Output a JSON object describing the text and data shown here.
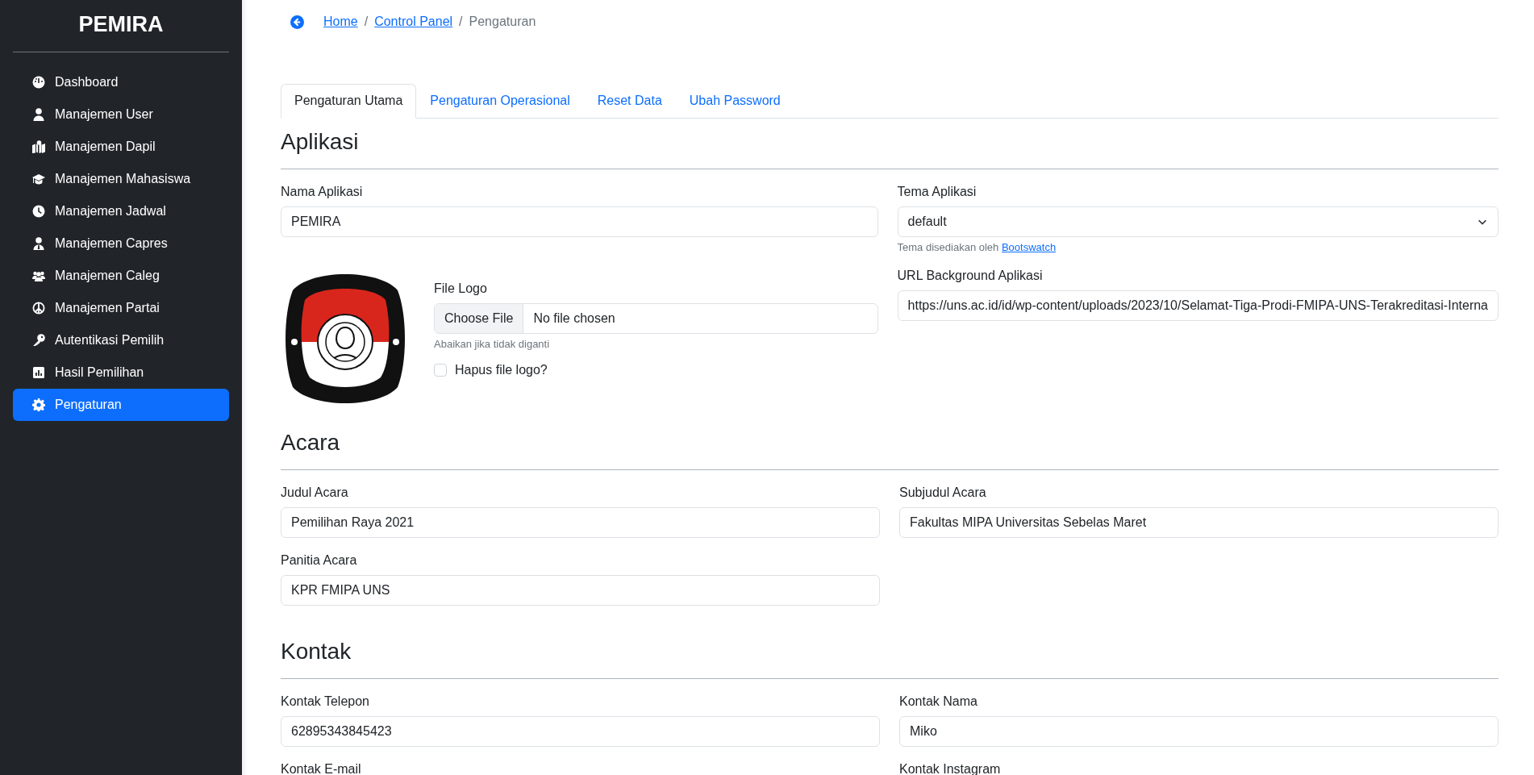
{
  "sidebar": {
    "brand": "PEMIRA",
    "items": [
      {
        "label": "Dashboard",
        "selected": false
      },
      {
        "label": "Manajemen User",
        "selected": false
      },
      {
        "label": "Manajemen Dapil",
        "selected": false
      },
      {
        "label": "Manajemen Mahasiswa",
        "selected": false
      },
      {
        "label": "Manajemen Jadwal",
        "selected": false
      },
      {
        "label": "Manajemen Capres",
        "selected": false
      },
      {
        "label": "Manajemen Caleg",
        "selected": false
      },
      {
        "label": "Manajemen Partai",
        "selected": false
      },
      {
        "label": "Autentikasi Pemilih",
        "selected": false
      },
      {
        "label": "Hasil Pemilihan",
        "selected": false
      },
      {
        "label": "Pengaturan",
        "selected": true
      }
    ]
  },
  "breadcrumb": [
    {
      "label": "Home",
      "kind": "link"
    },
    {
      "label": "/",
      "kind": "separator"
    },
    {
      "label": "Control Panel",
      "kind": "link"
    },
    {
      "label": "/",
      "kind": "separator"
    },
    {
      "label": "Pengaturan",
      "kind": "current"
    }
  ],
  "tabs": [
    {
      "label": "Pengaturan Utama",
      "selected": true
    },
    {
      "label": "Pengaturan Operasional",
      "selected": false
    },
    {
      "label": "Reset Data",
      "selected": false
    },
    {
      "label": "Ubah Password",
      "selected": false
    }
  ],
  "sections": [
    {
      "title": "Aplikasi",
      "columns": [
        [
          {
            "kind": "text",
            "label": "Nama Aplikasi",
            "value": "PEMIRA"
          },
          {
            "kind": "logo",
            "label": "File Logo",
            "button": "Choose File",
            "status": "No file chosen",
            "hint": "Abaikan jika tidak diganti",
            "checkbox": {
              "label": "Hapus file logo?",
              "checked": false
            }
          }
        ],
        [
          {
            "kind": "select",
            "label": "Tema Aplikasi",
            "value": "default",
            "help": "Tema disediakan oleh ",
            "help_link": "Bootswatch"
          },
          {
            "kind": "text",
            "label": "URL Background Aplikasi",
            "value": "https://uns.ac.id/id/wp-content/uploads/2023/10/Selamat-Tiga-Prodi-FMIPA-UNS-Terakreditasi-Interna"
          }
        ]
      ]
    },
    {
      "title": "Acara",
      "columns": [
        [
          {
            "kind": "text",
            "label": "Judul Acara",
            "value": "Pemilihan Raya 2021"
          },
          {
            "kind": "text",
            "label": "Panitia Acara",
            "value": "KPR FMIPA UNS"
          }
        ],
        [
          {
            "kind": "text",
            "label": "Subjudul Acara",
            "value": "Fakultas MIPA Universitas Sebelas Maret"
          }
        ]
      ]
    },
    {
      "title": "Kontak",
      "columns": [
        [
          {
            "kind": "text",
            "label": "Kontak Telepon",
            "value": "62895343845423"
          },
          {
            "kind": "text",
            "label": "Kontak E-mail"
          }
        ],
        [
          {
            "kind": "text",
            "label": "Kontak Nama",
            "value": "Miko"
          },
          {
            "kind": "text",
            "label": "Kontak Instagram"
          }
        ]
      ]
    }
  ]
}
